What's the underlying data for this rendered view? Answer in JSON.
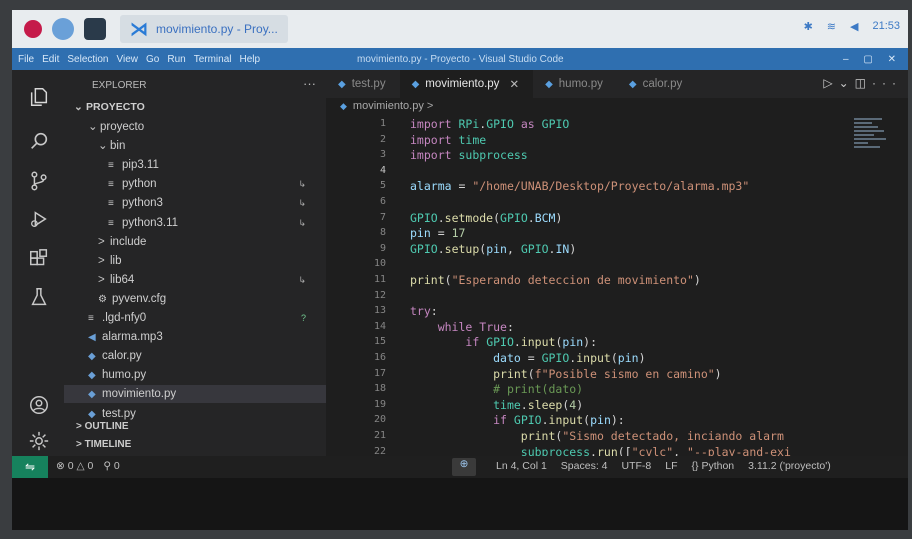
{
  "taskbar": {
    "task_title": "movimiento.py - Proy...",
    "clock": "21:53"
  },
  "titlebar": {
    "menus": [
      "File",
      "Edit",
      "Selection",
      "View",
      "Go",
      "Run",
      "Terminal",
      "Help"
    ],
    "window_title": "movimiento.py - Proyecto - Visual Studio Code"
  },
  "activity": {
    "icons": [
      "explorer-icon",
      "search-icon",
      "source-control-icon",
      "run-debug-icon",
      "extensions-icon",
      "testing-icon",
      "account-icon",
      "settings-icon"
    ]
  },
  "sidebar": {
    "header": "EXPLORER",
    "root": "PROYECTO",
    "items": [
      {
        "label": "proyecto",
        "arrow": "⌄",
        "indent": 1,
        "icon": ""
      },
      {
        "label": "bin",
        "arrow": "⌄",
        "indent": 2,
        "icon": ""
      },
      {
        "label": "pip3.11",
        "arrow": "",
        "indent": 3,
        "icon": "file-icon"
      },
      {
        "label": "python",
        "arrow": "",
        "indent": 3,
        "icon": "file-icon"
      },
      {
        "label": "python3",
        "arrow": "",
        "indent": 3,
        "icon": "file-icon"
      },
      {
        "label": "python3.11",
        "arrow": "",
        "indent": 3,
        "icon": "file-icon"
      },
      {
        "label": "include",
        "arrow": ">",
        "indent": 2,
        "icon": ""
      },
      {
        "label": "lib",
        "arrow": ">",
        "indent": 2,
        "icon": ""
      },
      {
        "label": "lib64",
        "arrow": ">",
        "indent": 2,
        "icon": ""
      },
      {
        "label": "pyvenv.cfg",
        "arrow": "",
        "indent": 2,
        "icon": "gear-icon"
      },
      {
        "label": ".lgd-nfy0",
        "arrow": "",
        "indent": 1,
        "icon": "file-icon"
      },
      {
        "label": "alarma.mp3",
        "arrow": "",
        "indent": 1,
        "icon": "audio-icon"
      },
      {
        "label": "calor.py",
        "arrow": "",
        "indent": 1,
        "icon": "python-icon"
      },
      {
        "label": "humo.py",
        "arrow": "",
        "indent": 1,
        "icon": "python-icon"
      },
      {
        "label": "movimiento.py",
        "arrow": "",
        "indent": 1,
        "icon": "python-icon"
      },
      {
        "label": "test.py",
        "arrow": "",
        "indent": 1,
        "icon": "python-icon"
      }
    ],
    "outline": "OUTLINE",
    "timeline": "TIMELINE",
    "question_mark": "?"
  },
  "editor": {
    "tabs": [
      {
        "label": "test.py",
        "active": false
      },
      {
        "label": "movimiento.py",
        "active": true
      },
      {
        "label": "humo.py",
        "active": false
      },
      {
        "label": "calor.py",
        "active": false
      }
    ],
    "breadcrumb": "movimiento.py >",
    "line_numbers": [
      "1",
      "2",
      "3",
      "4",
      "5",
      "6",
      "7",
      "8",
      "9",
      "10",
      "11",
      "12",
      "13",
      "14",
      "15",
      "16",
      "17",
      "18",
      "19",
      "20",
      "21",
      "22"
    ],
    "lines": [
      "import RPi.GPIO as GPIO",
      "import time",
      "import subprocess",
      "",
      "alarma = \"/home/UNAB/Desktop/Proyecto/alarma.mp3\"",
      "",
      "GPIO.setmode(GPIO.BCM)",
      "pin = 17",
      "GPIO.setup(pin, GPIO.IN)",
      "",
      "print(\"Esperando deteccion de movimiento\")",
      "",
      "try:",
      "    while True:",
      "        if GPIO.input(pin):",
      "            dato = GPIO.input(pin)",
      "            print(f\"Posible sismo en camino\")",
      "            # print(dato)",
      "            time.sleep(4)",
      "            if GPIO.input(pin):",
      "                print(\"Sismo detectado, inciando alarm",
      "                subprocess.run([\"cvlc\", \"--play-and-exi"
    ]
  },
  "statusbar": {
    "problems": "⊗ 0 △ 0",
    "ports": "⚲ 0",
    "position": "Ln 4, Col 1",
    "spaces": "Spaces: 4",
    "encoding": "UTF-8",
    "eol": "LF",
    "language": "{} Python",
    "interpreter": "3.11.2 ('proyecto')"
  }
}
